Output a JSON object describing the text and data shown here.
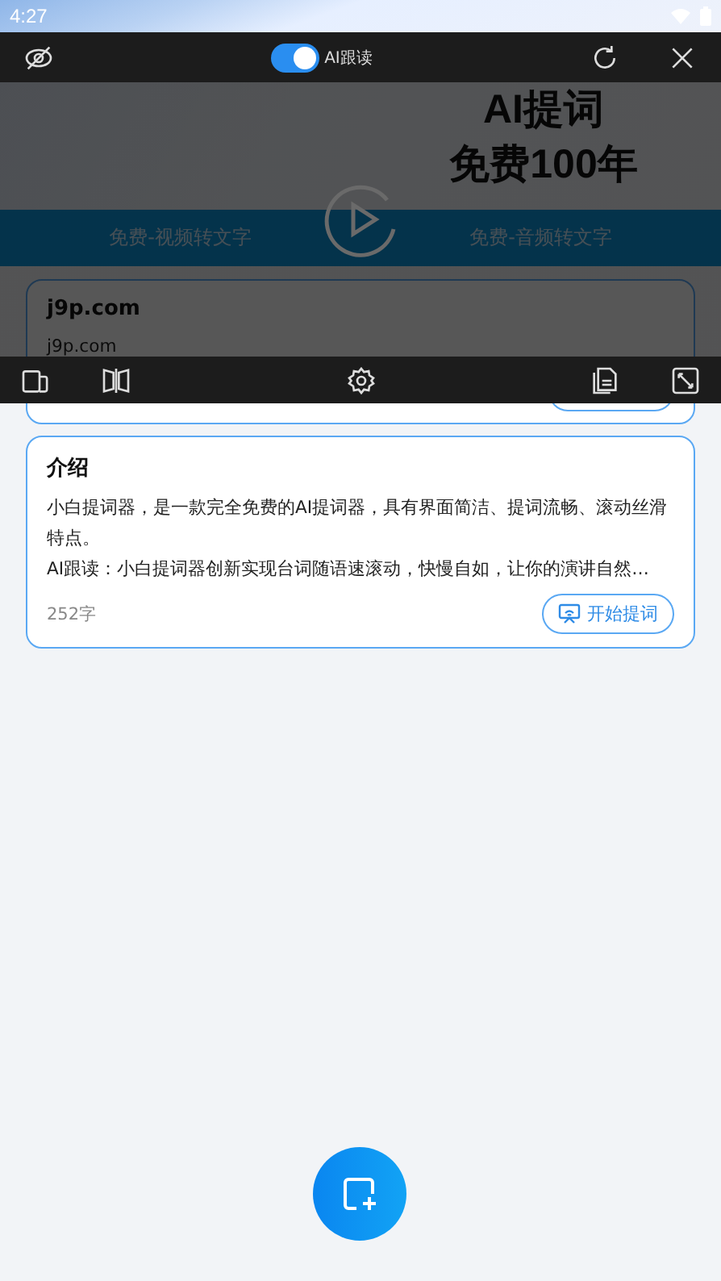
{
  "status_bar": {
    "time": "4:27"
  },
  "teleprompter": {
    "ai_follow": {
      "label": "AI跟读",
      "on": true
    }
  },
  "banner": {
    "headline": "AI提词",
    "subline": "免费100年",
    "links": [
      "免费-视频转文字",
      "免费-音频转文字"
    ]
  },
  "scripts": [
    {
      "title": "j9p.com",
      "preview": [
        "j9p.com"
      ]
    },
    {
      "title": "介绍",
      "preview": [
        "小白提词器，是一款完全免费的AI提词器，具有界面简洁、提词流畅、滚动丝滑特点。",
        "AI跟读：小白提词器创新实现台词随语速滚动，快慢自如，让你的演讲自然…"
      ],
      "count": "252字",
      "button": "开始提词"
    }
  ]
}
